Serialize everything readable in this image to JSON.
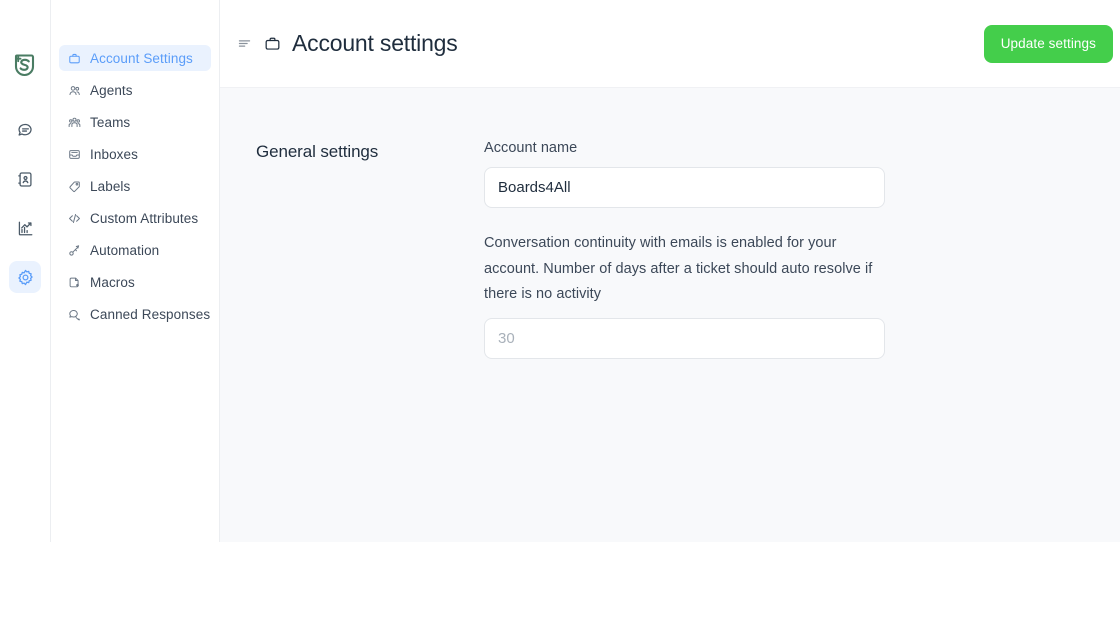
{
  "brand": {
    "logo_name": "chatwoot-logo",
    "logo_color": "#4a7c63"
  },
  "rail": {
    "items": [
      {
        "name": "conversations-icon",
        "label": "Conversations",
        "active": false
      },
      {
        "name": "contacts-icon",
        "label": "Contacts",
        "active": false
      },
      {
        "name": "reports-icon",
        "label": "Reports",
        "active": false
      },
      {
        "name": "settings-icon",
        "label": "Settings",
        "active": true
      }
    ],
    "active_color": "#5b9df9",
    "active_bg": "#eaf2fe"
  },
  "sidebar": {
    "items": [
      {
        "label": "Account Settings",
        "icon": "briefcase-icon",
        "active": true
      },
      {
        "label": "Agents",
        "icon": "agents-icon",
        "active": false
      },
      {
        "label": "Teams",
        "icon": "teams-icon",
        "active": false
      },
      {
        "label": "Inboxes",
        "icon": "inbox-icon",
        "active": false
      },
      {
        "label": "Labels",
        "icon": "tag-icon",
        "active": false
      },
      {
        "label": "Custom Attributes",
        "icon": "code-icon",
        "active": false
      },
      {
        "label": "Automation",
        "icon": "automation-icon",
        "active": false
      },
      {
        "label": "Macros",
        "icon": "macros-icon",
        "active": false
      },
      {
        "label": "Canned Responses",
        "icon": "canned-response-icon",
        "active": false
      }
    ]
  },
  "header": {
    "menu_icon": "list-collapse-icon",
    "page_icon": "briefcase-icon",
    "title": "Account settings",
    "update_button_label": "Update settings",
    "update_button_color": "#44ce4b"
  },
  "main": {
    "section_title": "General settings",
    "account_name": {
      "label": "Account name",
      "value": "Boards4All",
      "placeholder": ""
    },
    "auto_resolve": {
      "help_text": "Conversation continuity with emails is enabled for your account. Number of days after a ticket should auto resolve if there is no activity",
      "value": "",
      "placeholder": "30"
    }
  }
}
